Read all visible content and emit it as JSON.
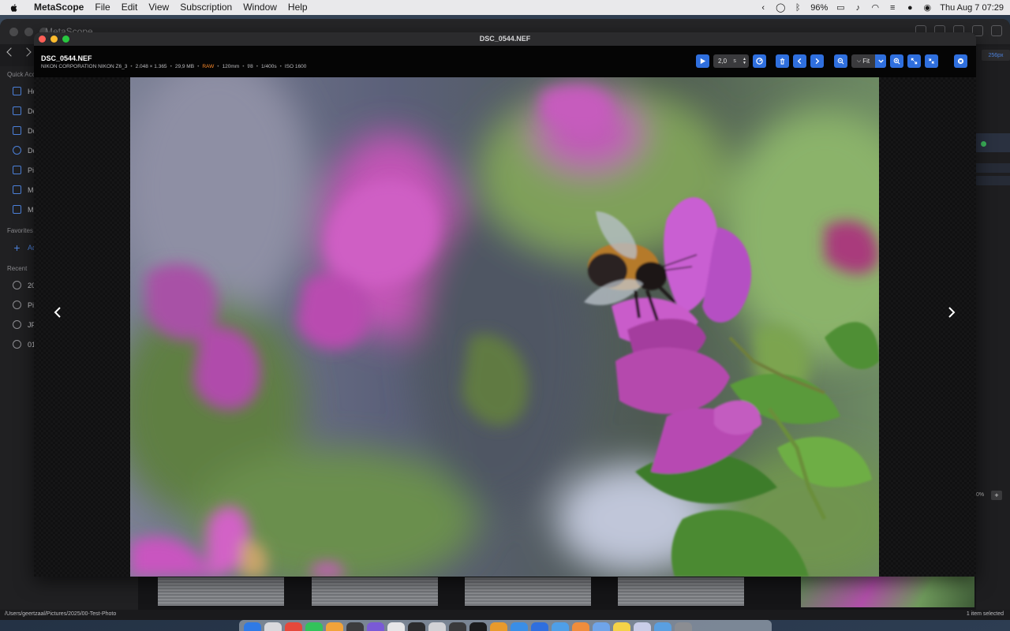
{
  "menubar": {
    "app_name": "MetaScope",
    "menus": [
      "File",
      "Edit",
      "View",
      "Subscription",
      "Window",
      "Help"
    ],
    "battery": "96%",
    "datetime": "Thu Aug 7  07:29"
  },
  "main_window": {
    "title": "MetaScope",
    "sidebar": {
      "quick_access_header": "Quick Acc",
      "quick_access": [
        "Ho",
        "De",
        "Do",
        "Do",
        "Pic",
        "Mo",
        "Mu"
      ],
      "favorites_header": "Favorites",
      "favorites_add": "Ad",
      "recent_header": "Recent",
      "recent": [
        "20",
        "Pic",
        "JP",
        "01"
      ]
    },
    "right_panel": {
      "resolution_badge": "256px",
      "zoom_percent": "0%",
      "add_label": "+"
    },
    "status": {
      "path": "/Users/geertzaal/Pictures/2025/00-Test-Photo",
      "selection": "1 item selected"
    }
  },
  "viewer": {
    "window_title": "DSC_0544.NEF",
    "file_name": "DSC_0544.NEF",
    "meta": {
      "camera": "NIKON CORPORATION NIKON Z6_3",
      "dimensions": "2.048 × 1.365",
      "size": "29,9 MB",
      "format": "RAW",
      "focal": "120mm",
      "aperture": "f/8",
      "shutter": "1/400s",
      "iso": "ISO 1600"
    },
    "toolbar": {
      "interval_value": "2,0",
      "interval_unit": "s",
      "zoom_mode": "Fit"
    },
    "colors": {
      "accent": "#2f6fde",
      "raw_badge": "#ff8b2a"
    }
  }
}
